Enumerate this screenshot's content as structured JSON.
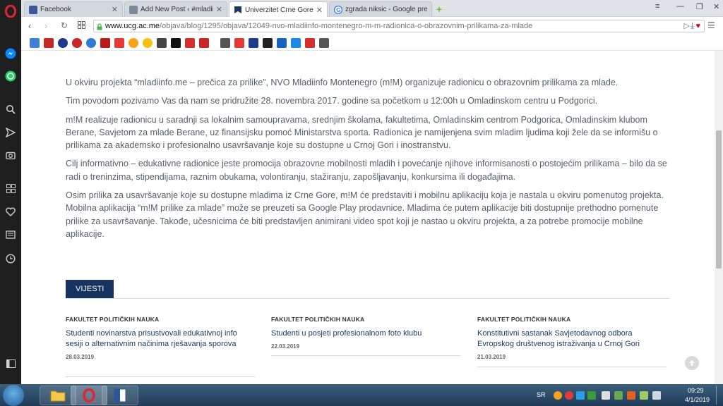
{
  "browser": {
    "tabs": [
      {
        "label": "Facebook",
        "color": "#3b5998"
      },
      {
        "label": "Add New Post ‹ #mladiinfo",
        "color": "#7a8a99"
      },
      {
        "label": "Univerzitet Crne Gore",
        "color": "#1c3b66"
      },
      {
        "label": "zgrada niksic - Google pre",
        "color": "#4285f4"
      }
    ],
    "url_host": "www.ucg.ac.me",
    "url_path": "/objava/blog/1295/objava/12049-nvo-mladiinfo-montenegro-m-m-radionica-o-obrazovnim-prilikama-za-mlade"
  },
  "article": {
    "paragraphs": [
      "U okviru projekta “mladiinfo.me – prečica za prilike”, NVO Mladiinfo Montenegro (m!M) organizuje radionicu o obrazovnim prilikama za mlade.",
      "Tim povodom pozivamo Vas da nam se pridružite  28. novembra 2017. godine sa početkom u 12:00h u Omladinskom centru u Podgorici.",
      "m!M realizuje radionicu u saradnji sa lokalnim samoupravama, srednjim školama, fakultetima, Omladinskim centrom Podgorica, Omladinskim klubom Berane, Savjetom za mlade Berane, uz finansijsku pomoć Ministarstva sporta. Radionica je namijenjena svim mladim ljudima koji žele da se informišu o prilikama za akademsko i profesionalno usavršavanje koje su dostupne u Crnoj Gori i inostranstvu.",
      "Cilj informativno – edukativne radionice jeste promocija obrazovne mobilnosti mladih i povećanje njihove informisanosti o postojećim prilikama – bilo da se radi o treninzima, stipendijama, raznim obukama, volontiranju, stažiranju, zapošljavanju, konkursima ili događajima.",
      "Osim prilika za usavršavanje koje su dostupne mladima iz Crne Gore, m!M će predstaviti i mobilnu aplikaciju koja je nastala u okviru pomenutog projekta. Mobilna aplikacija “m!M prilike za mlade” može se preuzeti sa Google Play prodavnice. Mladima će putem aplikacije biti dostupnije prethodno pomenute prilike za usavršavanje. Takođe, učesnicima će biti predstavljen animirani video spot koji je nastao u okviru projekta, a za potrebe promocije mobilne aplikacije."
    ]
  },
  "news": {
    "section_label": "VIJESTI",
    "items": [
      {
        "category": "FAKULTET POLITIČKIH NAUKA",
        "title": "Studenti novinarstva prisustvovali edukativnoj info sesiji o alternativnim načinima rješavanja sporova",
        "date": "28.03.2019"
      },
      {
        "category": "FAKULTET POLITIČKIH NAUKA",
        "title": "Studenti u posjeti profesionalnom foto klubu",
        "date": "22.03.2019"
      },
      {
        "category": "FAKULTET POLITIČKIH NAUKA",
        "title": "Konstitutivni sastanak Savjetodavnog odbora Evropskog društvenog istraživanja u Crnoj Gori",
        "date": "21.03.2019"
      }
    ]
  },
  "taskbar": {
    "lang": "SR",
    "time": "09:29",
    "date": "4/1/2019"
  },
  "colors": {
    "accent": "#15345f",
    "link": "#1c3b66",
    "opera_red": "#cc0f16"
  }
}
